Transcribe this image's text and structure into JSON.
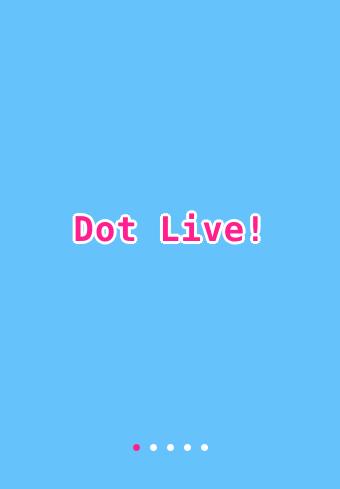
{
  "app": {
    "logo_text": "Dot Live!"
  },
  "pager": {
    "count": 5,
    "active_index": 0,
    "dots": [
      {
        "active": true
      },
      {
        "active": false
      },
      {
        "active": false
      },
      {
        "active": false
      },
      {
        "active": false
      }
    ]
  },
  "colors": {
    "background": "#66c2fb",
    "logo_fill": "#ff1f8e",
    "logo_outline": "#ffffff",
    "dot_active": "#ff1f8e",
    "dot_inactive": "#ffffff"
  }
}
